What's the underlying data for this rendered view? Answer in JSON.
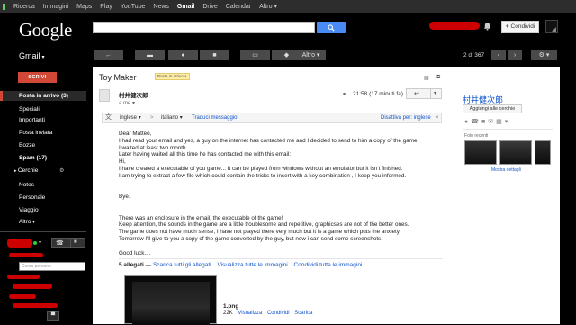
{
  "topbar": {
    "items": [
      "Ricerca",
      "Immagini",
      "Maps",
      "Play",
      "YouTube",
      "News",
      "Gmail",
      "Drive",
      "Calendar",
      "Altro"
    ],
    "active_index": 6,
    "more_caret": "▾"
  },
  "header": {
    "logo": "Google",
    "search_placeholder": "",
    "share_label": "Condividi",
    "share_plus": "+"
  },
  "toolbar": {
    "app_label": "Gmail",
    "more_label": "Altro",
    "pager": "2 di 367"
  },
  "sidebar": {
    "compose_label": "SCRIVI",
    "items": [
      {
        "label": "Posta in arrivo (3)",
        "bold": true
      },
      {
        "label": "Speciali",
        "bold": false
      },
      {
        "label": "Importanti",
        "bold": false
      },
      {
        "label": "Posta inviata",
        "bold": false
      },
      {
        "label": "Bozze",
        "bold": false
      },
      {
        "label": "Spam (17)",
        "bold": true
      },
      {
        "label": "Cerchie",
        "bold": false
      },
      {
        "label": "Notes",
        "bold": false
      },
      {
        "label": "Personale",
        "bold": false
      },
      {
        "label": "Viaggio",
        "bold": false
      },
      {
        "label": "Altro",
        "bold": false
      }
    ],
    "people_search_placeholder": "Cerca persone"
  },
  "message": {
    "subject": "Toy Maker",
    "inbox_badge": "Posta in arrivo",
    "sender": "村井健次郎",
    "recipient": "a me",
    "timestamp": "21:58 (17 minuti fa)",
    "translate": {
      "from": "inglese",
      "arrow": ">",
      "to": "italiano",
      "action": "Traduci messaggio",
      "disable": "Disattiva per: inglese"
    },
    "body": [
      "Dear Matteo,",
      "I had read your email and yes, a guy on the internet has contacted me and I decided to send to him a copy of the game.",
      "I waited at least two month.",
      "Later having waited all this time he has contacted me with this email:",
      "Hi,",
      "I have created a executable of you game... It can be played from windows without an emulator but it isn't finished.",
      "I am trying to extract a few file which could contain the tricks to insert with a key combination , I keep you informed.",
      "",
      "",
      "Bye.",
      "",
      "",
      "There was an enclosure in the email, the executable of the game!",
      "Keep attention, the sounds in the game are a little troublesome and repetitive, graphicses are not of the better ones.",
      "The game does not have much sense, I have not played there very much but it is a game which puts the anxiety.",
      "Tomorrow I'll give to you a copy of the game converted by the guy, but now i can send some screenshots.",
      "",
      "Good luck...."
    ],
    "attachments": {
      "count_label": "5 allegati",
      "dash": "—",
      "download_all": "Scarica tutti gli allegati",
      "view_all": "Visualizza tutte le immagini",
      "share_all": "Condividi tutte le immagini",
      "file_name": "1.png",
      "file_size": "22K",
      "view": "Visualizza",
      "share": "Condividi",
      "download": "Scarica"
    }
  },
  "contact_panel": {
    "name": "村井健次郎",
    "add_label": "Aggiungi alle cerchie",
    "recent_label": "Foto recenti",
    "more_label": "Mostra dettagli"
  },
  "colors": {
    "accent_red": "#d14836",
    "search_blue": "#4a8af4",
    "link_blue": "#1155cc",
    "redaction": "#cc0000"
  }
}
